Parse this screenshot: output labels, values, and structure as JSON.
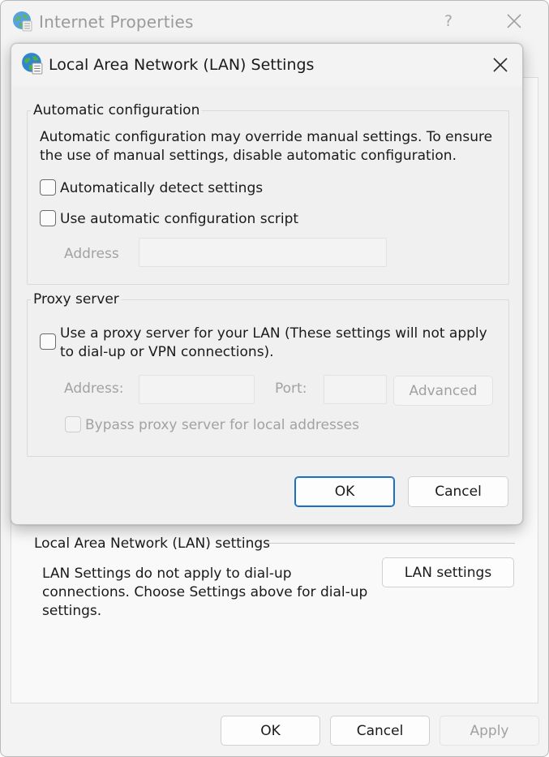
{
  "parent": {
    "title": "Internet Properties",
    "help_glyph": "?",
    "lan_group_title": "Local Area Network (LAN) settings",
    "lan_description": "LAN Settings do not apply to dial-up connections. Choose Settings above for dial-up settings.",
    "lan_settings_button": "LAN settings",
    "ok_button": "OK",
    "cancel_button": "Cancel",
    "apply_button": "Apply"
  },
  "dialog": {
    "title": "Local Area Network (LAN) Settings",
    "auto_config": {
      "group_title": "Automatic configuration",
      "description": "Automatic configuration may override manual settings.  To ensure the use of manual settings, disable automatic configuration.",
      "detect_label": "Automatically detect settings",
      "detect_checked": false,
      "script_label": "Use automatic configuration script",
      "script_checked": false,
      "address_label": "Address",
      "address_value": ""
    },
    "proxy": {
      "group_title": "Proxy server",
      "use_proxy_label": "Use a proxy server for your LAN (These settings will not apply to dial-up or VPN connections).",
      "use_proxy_checked": false,
      "address_label": "Address:",
      "address_value": "",
      "port_label": "Port:",
      "port_value": "",
      "advanced_button": "Advanced",
      "bypass_label": "Bypass proxy server for local addresses",
      "bypass_checked": false
    },
    "ok_button": "OK",
    "cancel_button": "Cancel"
  },
  "icons": {
    "window_icon": "internet-globe-icon",
    "close": "close-icon"
  },
  "colors": {
    "accent_focus": "#1b6fbf",
    "disabled_text": "#a2a2a2"
  }
}
